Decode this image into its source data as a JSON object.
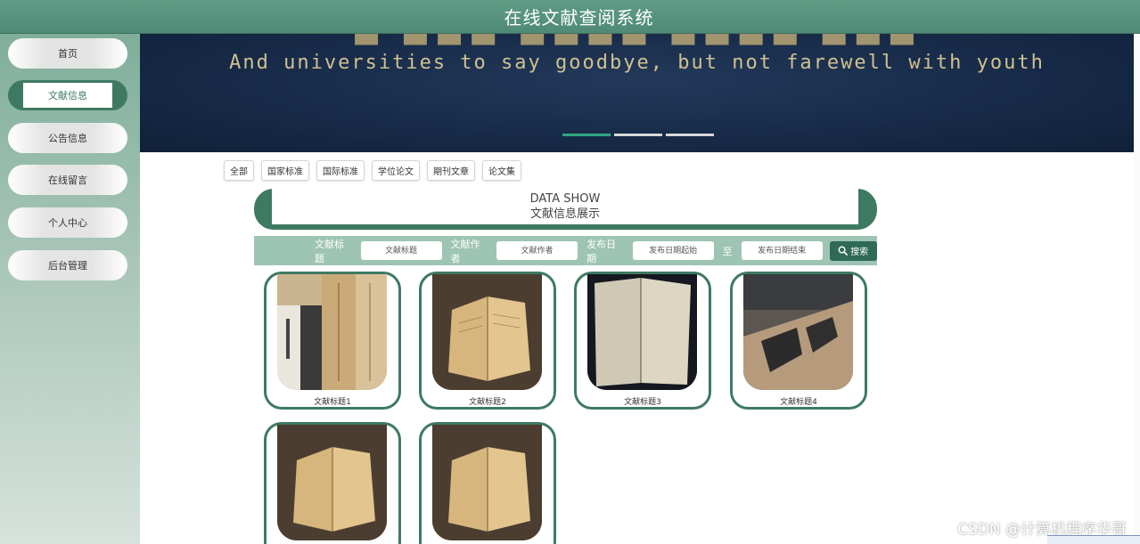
{
  "header": {
    "title": "在线文献查阅系统"
  },
  "sidebar": {
    "items": [
      {
        "label": "首页",
        "active": false
      },
      {
        "label": "文献信息",
        "active": true
      },
      {
        "label": "公告信息",
        "active": false
      },
      {
        "label": "在线留言",
        "active": false
      },
      {
        "label": "个人中心",
        "active": false
      },
      {
        "label": "后台管理",
        "active": false
      }
    ]
  },
  "banner": {
    "line2": "And universities to say goodbye, but not farewell with youth",
    "slide_count": 3,
    "active_slide": 1
  },
  "filters": [
    "全部",
    "国家标准",
    "国际标准",
    "学位论文",
    "期刊文章",
    "论文集"
  ],
  "data_show": {
    "en": "DATA SHOW",
    "cn": "文献信息展示"
  },
  "search": {
    "title_label": "文献标题",
    "title_placeholder": "文献标题",
    "author_label": "文献作者",
    "author_placeholder": "文献作者",
    "date_label": "发布日期",
    "date_start_placeholder": "发布日期起始",
    "to_label": "至",
    "date_end_placeholder": "发布日期结束",
    "button_label": "搜索"
  },
  "cards": [
    {
      "label": "文献标题1"
    },
    {
      "label": "文献标题2"
    },
    {
      "label": "文献标题3"
    },
    {
      "label": "文献标题4"
    },
    {
      "label": ""
    },
    {
      "label": ""
    }
  ],
  "watermark": "CSDN @计算机程序华哥",
  "colors": {
    "primary": "#3e7a62",
    "header": "#5f9c86",
    "search_bar": "#9ec4b3",
    "banner": "#162a47"
  }
}
